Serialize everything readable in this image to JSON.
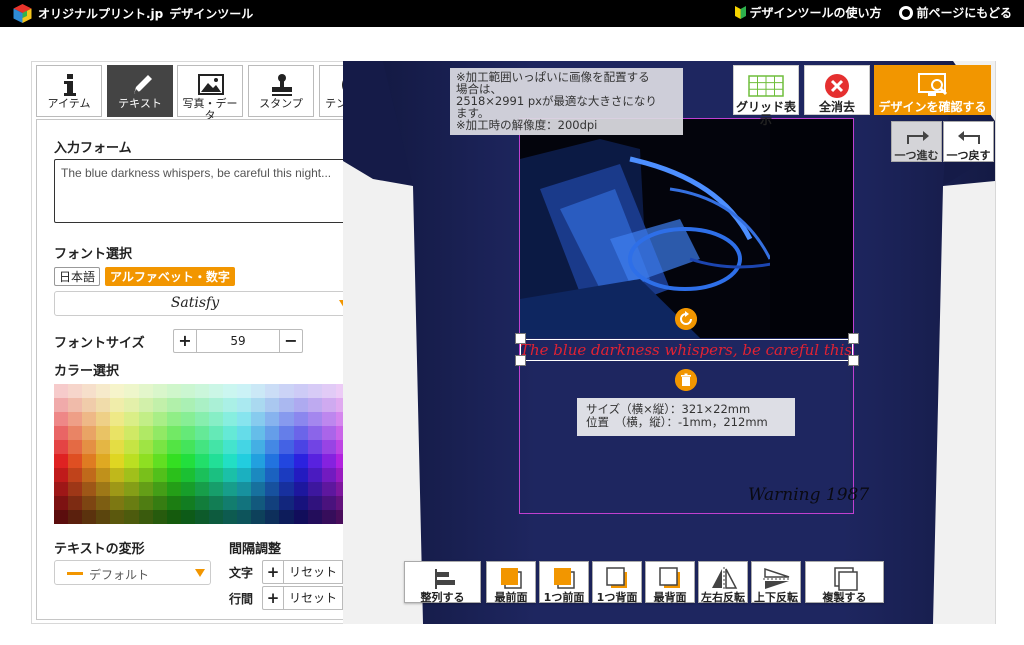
{
  "header": {
    "logo_title": "オリジナルプリント.jp",
    "logo_subtitle": "デザインツール",
    "links": [
      {
        "label": "デザインツールの使い方",
        "icon": "beginner-leaf-icon"
      },
      {
        "label": "前ページにもどる",
        "icon": "back-circle-icon"
      }
    ]
  },
  "tabs": [
    {
      "label": "アイテム",
      "icon": "info-icon"
    },
    {
      "label": "テキスト",
      "icon": "pen-icon",
      "active": true
    },
    {
      "label": "写真・データ",
      "icon": "photo-icon"
    },
    {
      "label": "スタンプ",
      "icon": "stamp-icon"
    },
    {
      "label": "テンプレート",
      "icon": "template-icon"
    }
  ],
  "text_panel": {
    "input_label": "入力フォーム",
    "input_value": "The blue darkness whispers, be careful this night...",
    "font_label": "フォント選択",
    "lang_japanese": "日本語",
    "lang_alphanumeric": "アルファベット・数字",
    "font_value": "Satisfy",
    "size_label": "フォントサイズ",
    "size_value": "59",
    "plus": "+",
    "minus": "−",
    "color_label": "カラー選択",
    "transform_label": "テキストの変形",
    "transform_value": "デフォルト",
    "spacing_label": "間隔調整",
    "char_spacing_label": "文字",
    "line_spacing_label": "行間",
    "reset_label": "リセット"
  },
  "canvas": {
    "info_note": [
      "※加工範囲いっぱいに画像を配置する",
      "場合は、",
      "2518×2991 pxが最適な大きさになり",
      "ます。",
      "※加工時の解像度：200dpi"
    ],
    "selected_text": "The blue darkness whispers, be careful this night...",
    "signature_text": "Warning 1987",
    "size_info": "サイズ（横×縦）：321×22mm",
    "position_info": "位置　（横，縦）：-1mm，212mm"
  },
  "top_buttons": [
    {
      "label": "グリッド表示",
      "icon": "grid-icon"
    },
    {
      "label": "全消去",
      "icon": "clear-all-icon"
    },
    {
      "label": "デザインを確認する",
      "icon": "preview-icon"
    }
  ],
  "history_buttons": {
    "redo": "一つ進む",
    "undo": "一つ戻す"
  },
  "bottom_toolbar": [
    {
      "label": "整列する",
      "icon": "align-icon"
    },
    {
      "label": "最前面",
      "icon": "bring-front-icon"
    },
    {
      "label": "1つ前面",
      "icon": "bring-forward-icon"
    },
    {
      "label": "1つ背面",
      "icon": "send-backward-icon"
    },
    {
      "label": "最背面",
      "icon": "send-back-icon"
    },
    {
      "label": "左右反転",
      "icon": "flip-horizontal-icon"
    },
    {
      "label": "上下反転",
      "icon": "flip-vertical-icon"
    },
    {
      "label": "複製する",
      "icon": "duplicate-icon"
    }
  ],
  "colors": {
    "accent": "#f29600",
    "shirt": "#1c2356",
    "text_color": "#e02233",
    "selection_border": "#c040d0"
  }
}
